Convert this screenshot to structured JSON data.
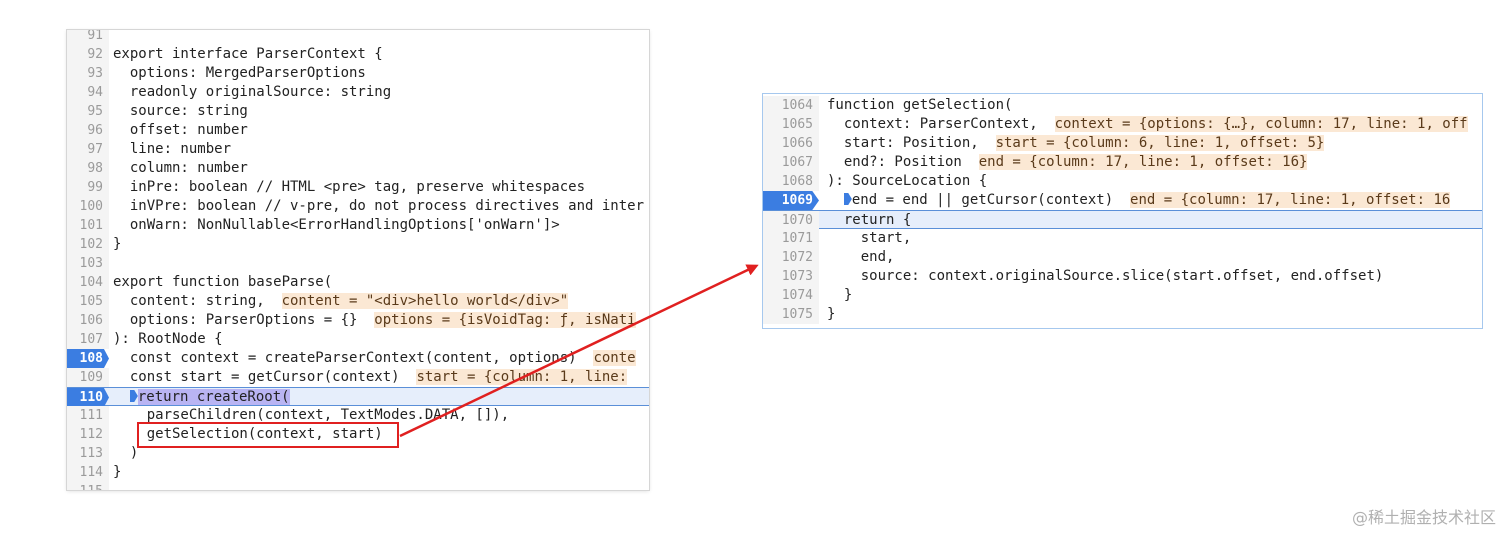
{
  "left_editor": {
    "lines": [
      {
        "n": "91",
        "code": ""
      },
      {
        "n": "92",
        "code": "export interface ParserContext {"
      },
      {
        "n": "93",
        "code": "  options: MergedParserOptions"
      },
      {
        "n": "94",
        "code": "  readonly originalSource: string"
      },
      {
        "n": "95",
        "code": "  source: string"
      },
      {
        "n": "96",
        "code": "  offset: number"
      },
      {
        "n": "97",
        "code": "  line: number"
      },
      {
        "n": "98",
        "code": "  column: number"
      },
      {
        "n": "99",
        "code": "  inPre: boolean // HTML <pre> tag, preserve whitespaces"
      },
      {
        "n": "100",
        "code": "  inVPre: boolean // v-pre, do not process directives and inter"
      },
      {
        "n": "101",
        "code": "  onWarn: NonNullable<ErrorHandlingOptions['onWarn']>"
      },
      {
        "n": "102",
        "code": "}"
      },
      {
        "n": "103",
        "code": ""
      },
      {
        "n": "104",
        "code": "export function baseParse("
      },
      {
        "n": "105",
        "code": "  content: string,",
        "inline": "content = \"<div>hello world</div>\""
      },
      {
        "n": "106",
        "code": "  options: ParserOptions = {}",
        "inline": "options = {isVoidTag: ƒ, isNati"
      },
      {
        "n": "107",
        "code": "): RootNode {"
      },
      {
        "n": "108",
        "code": "  const context = createParserContext(content, options)",
        "inline": "conte",
        "breakpoint": true
      },
      {
        "n": "109",
        "code": "  const start = getCursor(context)",
        "inline": "start = {column: 1, line:"
      },
      {
        "n": "110",
        "code": "return createRoot(",
        "breakpoint": true,
        "exec": true
      },
      {
        "n": "111",
        "code": "    parseChildren(context, TextModes.DATA, []),"
      },
      {
        "n": "112",
        "code": "    getSelection(context, start)"
      },
      {
        "n": "113",
        "code": "  )"
      },
      {
        "n": "114",
        "code": "}"
      },
      {
        "n": "115",
        "code": ""
      }
    ]
  },
  "right_editor": {
    "lines": [
      {
        "n": "1064",
        "code": "function getSelection("
      },
      {
        "n": "1065",
        "code": "  context: ParserContext,",
        "inline": "context = {options: {…}, column: 17, line: 1, off"
      },
      {
        "n": "1066",
        "code": "  start: Position,",
        "inline": "start = {column: 6, line: 1, offset: 5}"
      },
      {
        "n": "1067",
        "code": "  end?: Position",
        "inline": "end = {column: 17, line: 1, offset: 16}"
      },
      {
        "n": "1068",
        "code": "): SourceLocation {"
      },
      {
        "n": "1069",
        "code": "end = end || getCursor(context)",
        "inline": "end = {column: 17, line: 1, offset: 16",
        "breakpoint": true
      },
      {
        "n": "1070",
        "code": "  return {",
        "exec": true
      },
      {
        "n": "1071",
        "code": "    start,"
      },
      {
        "n": "1072",
        "code": "    end,"
      },
      {
        "n": "1073",
        "code": "    source: context.originalSource.slice(start.offset, end.offset)"
      },
      {
        "n": "1074",
        "code": "  }"
      },
      {
        "n": "1075",
        "code": "}"
      }
    ]
  },
  "annotation_color": "#e02020",
  "watermark": "@稀土掘金技术社区"
}
